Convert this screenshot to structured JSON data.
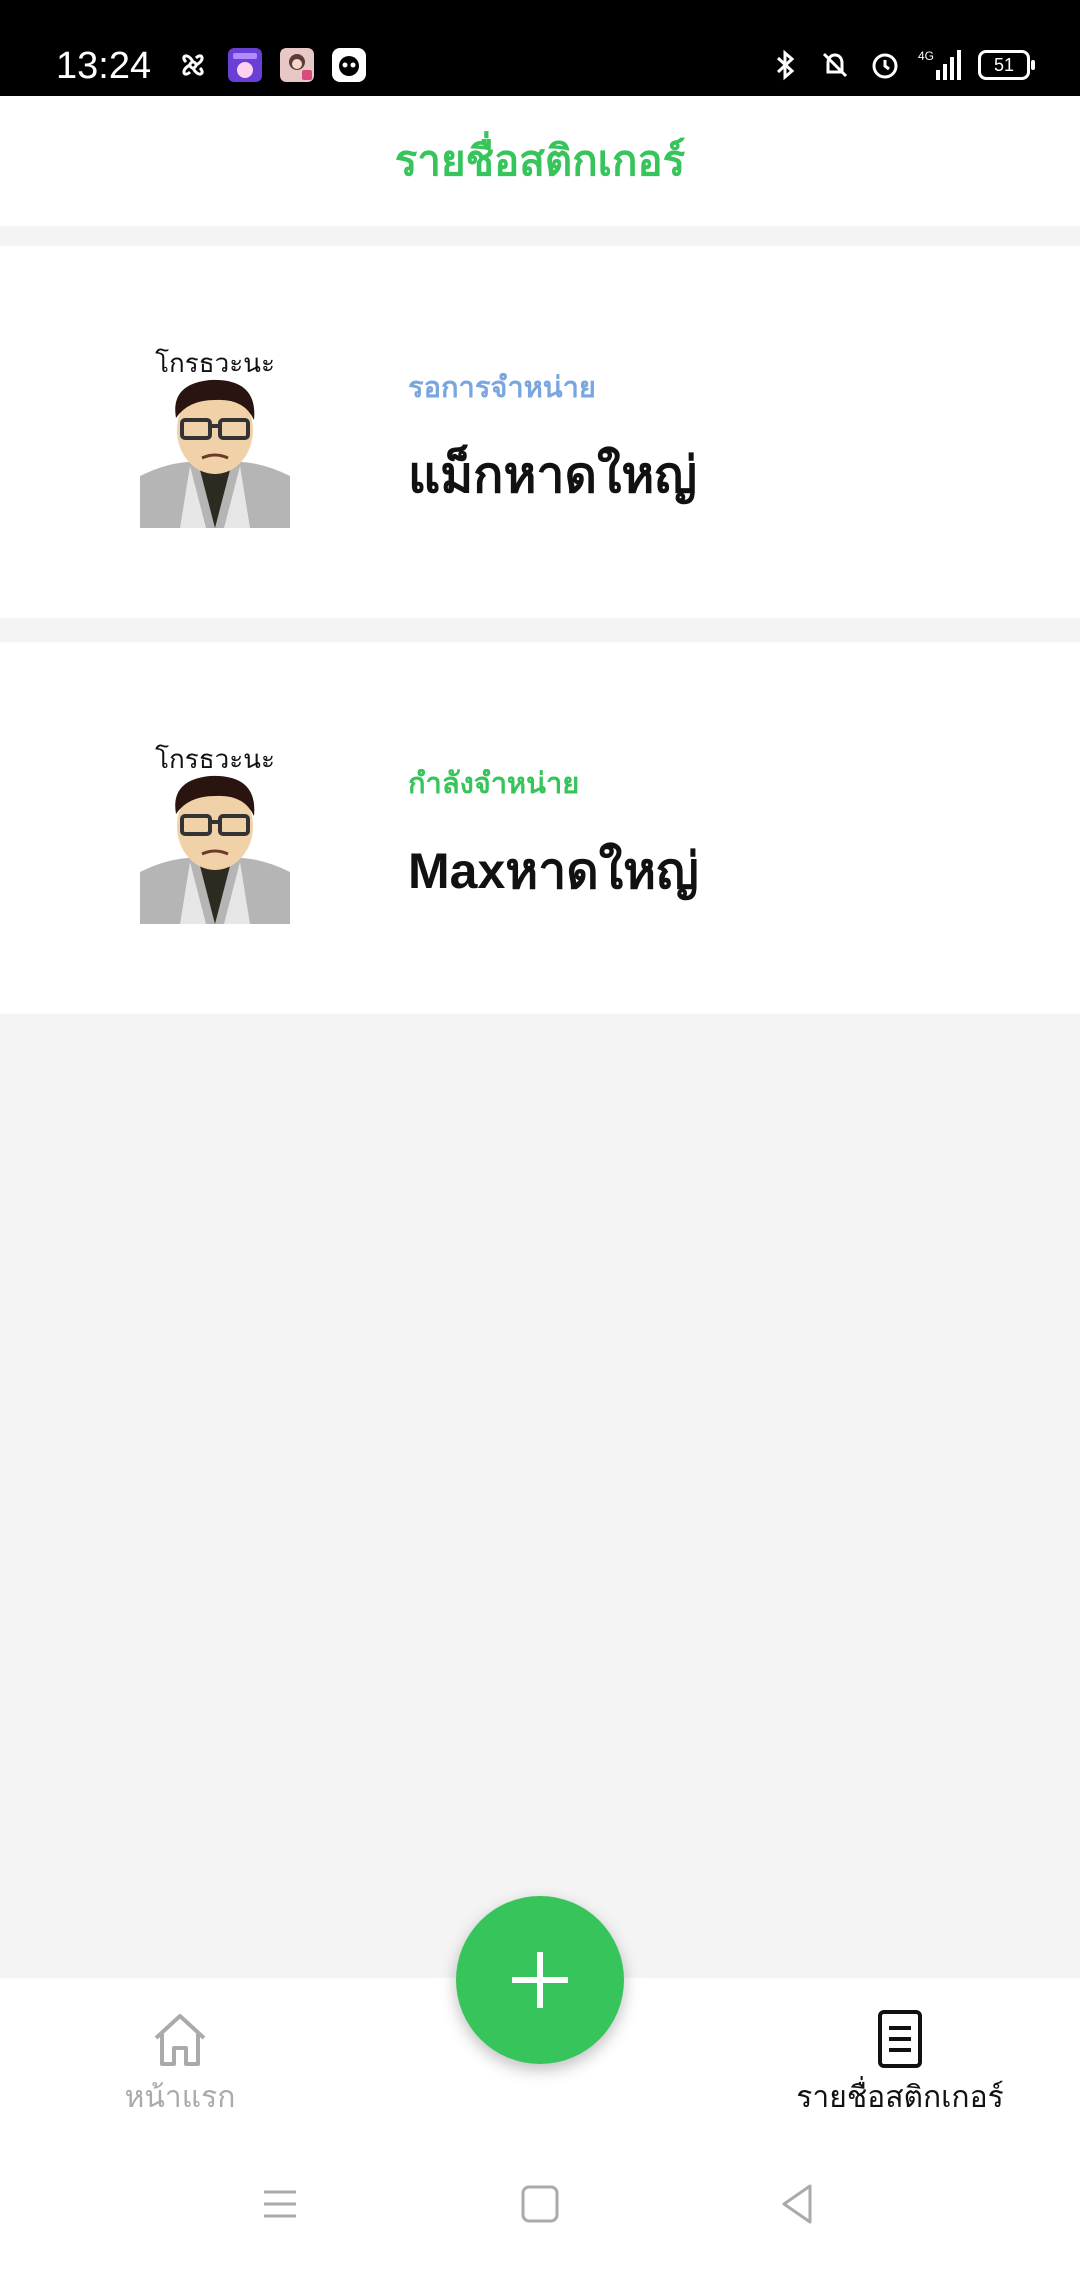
{
  "status_bar": {
    "time": "13:24",
    "battery": "51",
    "left_icons": [
      "fan-icon",
      "manga-app-icon",
      "photo-app-icon",
      "bot-app-icon"
    ],
    "right_icons": [
      "bluetooth-icon",
      "mute-icon",
      "alarm-icon",
      "signal-icon"
    ],
    "network_label": "4G"
  },
  "header": {
    "title": "รายชื่อสติกเกอร์"
  },
  "stickers": [
    {
      "status": "รอการจำหน่าย",
      "status_color": "#7aa6e0",
      "name": "แม็กหาดใหญ่"
    },
    {
      "status": "กำลังจำหน่าย",
      "status_color": "#36c45b",
      "name": "Maxหาดใหญ่"
    }
  ],
  "sticker_caption": "โกรธวะนะ",
  "fab": {
    "icon": "plus-icon"
  },
  "bottom_nav": {
    "home_label": "หน้าแรก",
    "list_label": "รายชื่อสติกเกอร์"
  },
  "colors": {
    "accent": "#36c45b",
    "pending": "#7aa6e0",
    "background": "#f4f4f4"
  }
}
